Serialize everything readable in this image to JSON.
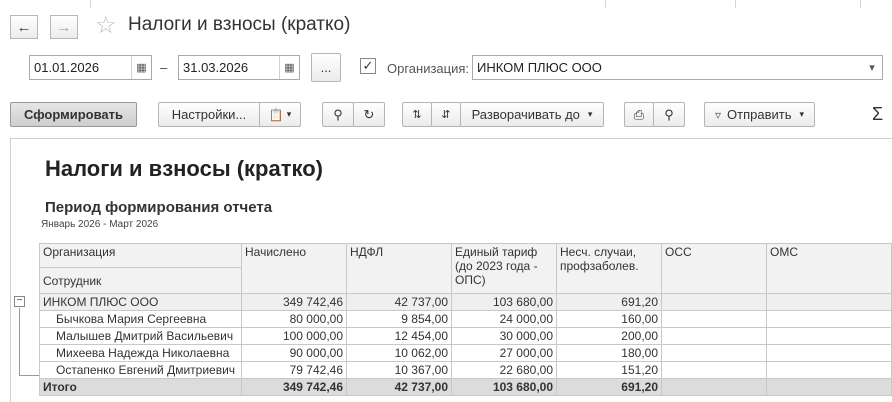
{
  "header": {
    "title": "Налоги и взносы (кратко)",
    "back_icon": "arrow-left",
    "forward_icon": "arrow-right"
  },
  "filters": {
    "date_from": "01.01.2026",
    "date_sep": "–",
    "date_to": "31.03.2026",
    "period_button": "...",
    "org_checked": true,
    "org_label": "Организация:",
    "org_value": "ИНКОМ ПЛЮС ООО"
  },
  "toolbar": {
    "generate": "Сформировать",
    "settings": "Настройки...",
    "expand_to": "Разворачивать до",
    "send": "Отправить",
    "sum_icon": "Σ"
  },
  "report": {
    "title": "Налоги и взносы (кратко)",
    "subtitle": "Период формирования отчета",
    "period": "Январь 2026 - Март 2026",
    "columns": {
      "org": "Организация",
      "employee": "Сотрудник",
      "accrued": "Начислено",
      "ndfl": "НДФЛ",
      "single_tariff_l1": "Единый тариф",
      "single_tariff_l2": "(до 2023 года -",
      "single_tariff_l3": "ОПС)",
      "accident_l1": "Несч. случаи,",
      "accident_l2": "профзаболев.",
      "oss": "ОСС",
      "oms": "ОМС"
    },
    "org_row": {
      "name": "ИНКОМ ПЛЮС ООО",
      "accrued": "349 742,46",
      "ndfl": "42 737,00",
      "tariff": "103 680,00",
      "accident": "691,20",
      "oss": "",
      "oms": ""
    },
    "rows": [
      {
        "name": "Бычкова Мария Сергеевна",
        "accrued": "80 000,00",
        "ndfl": "9 854,00",
        "tariff": "24 000,00",
        "accident": "160,00",
        "oss": "",
        "oms": ""
      },
      {
        "name": "Малышев Дмитрий Васильевич",
        "accrued": "100 000,00",
        "ndfl": "12 454,00",
        "tariff": "30 000,00",
        "accident": "200,00",
        "oss": "",
        "oms": ""
      },
      {
        "name": "Михеева Надежда Николаевна",
        "accrued": "90 000,00",
        "ndfl": "10 062,00",
        "tariff": "27 000,00",
        "accident": "180,00",
        "oss": "",
        "oms": ""
      },
      {
        "name": "Остапенко Евгений Дмитриевич",
        "accrued": "79 742,46",
        "ndfl": "10 367,00",
        "tariff": "22 680,00",
        "accident": "151,20",
        "oss": "",
        "oms": ""
      }
    ],
    "total_row": {
      "name": "Итого",
      "accrued": "349 742,46",
      "ndfl": "42 737,00",
      "tariff": "103 680,00",
      "accident": "691,20",
      "oss": "",
      "oms": ""
    }
  }
}
